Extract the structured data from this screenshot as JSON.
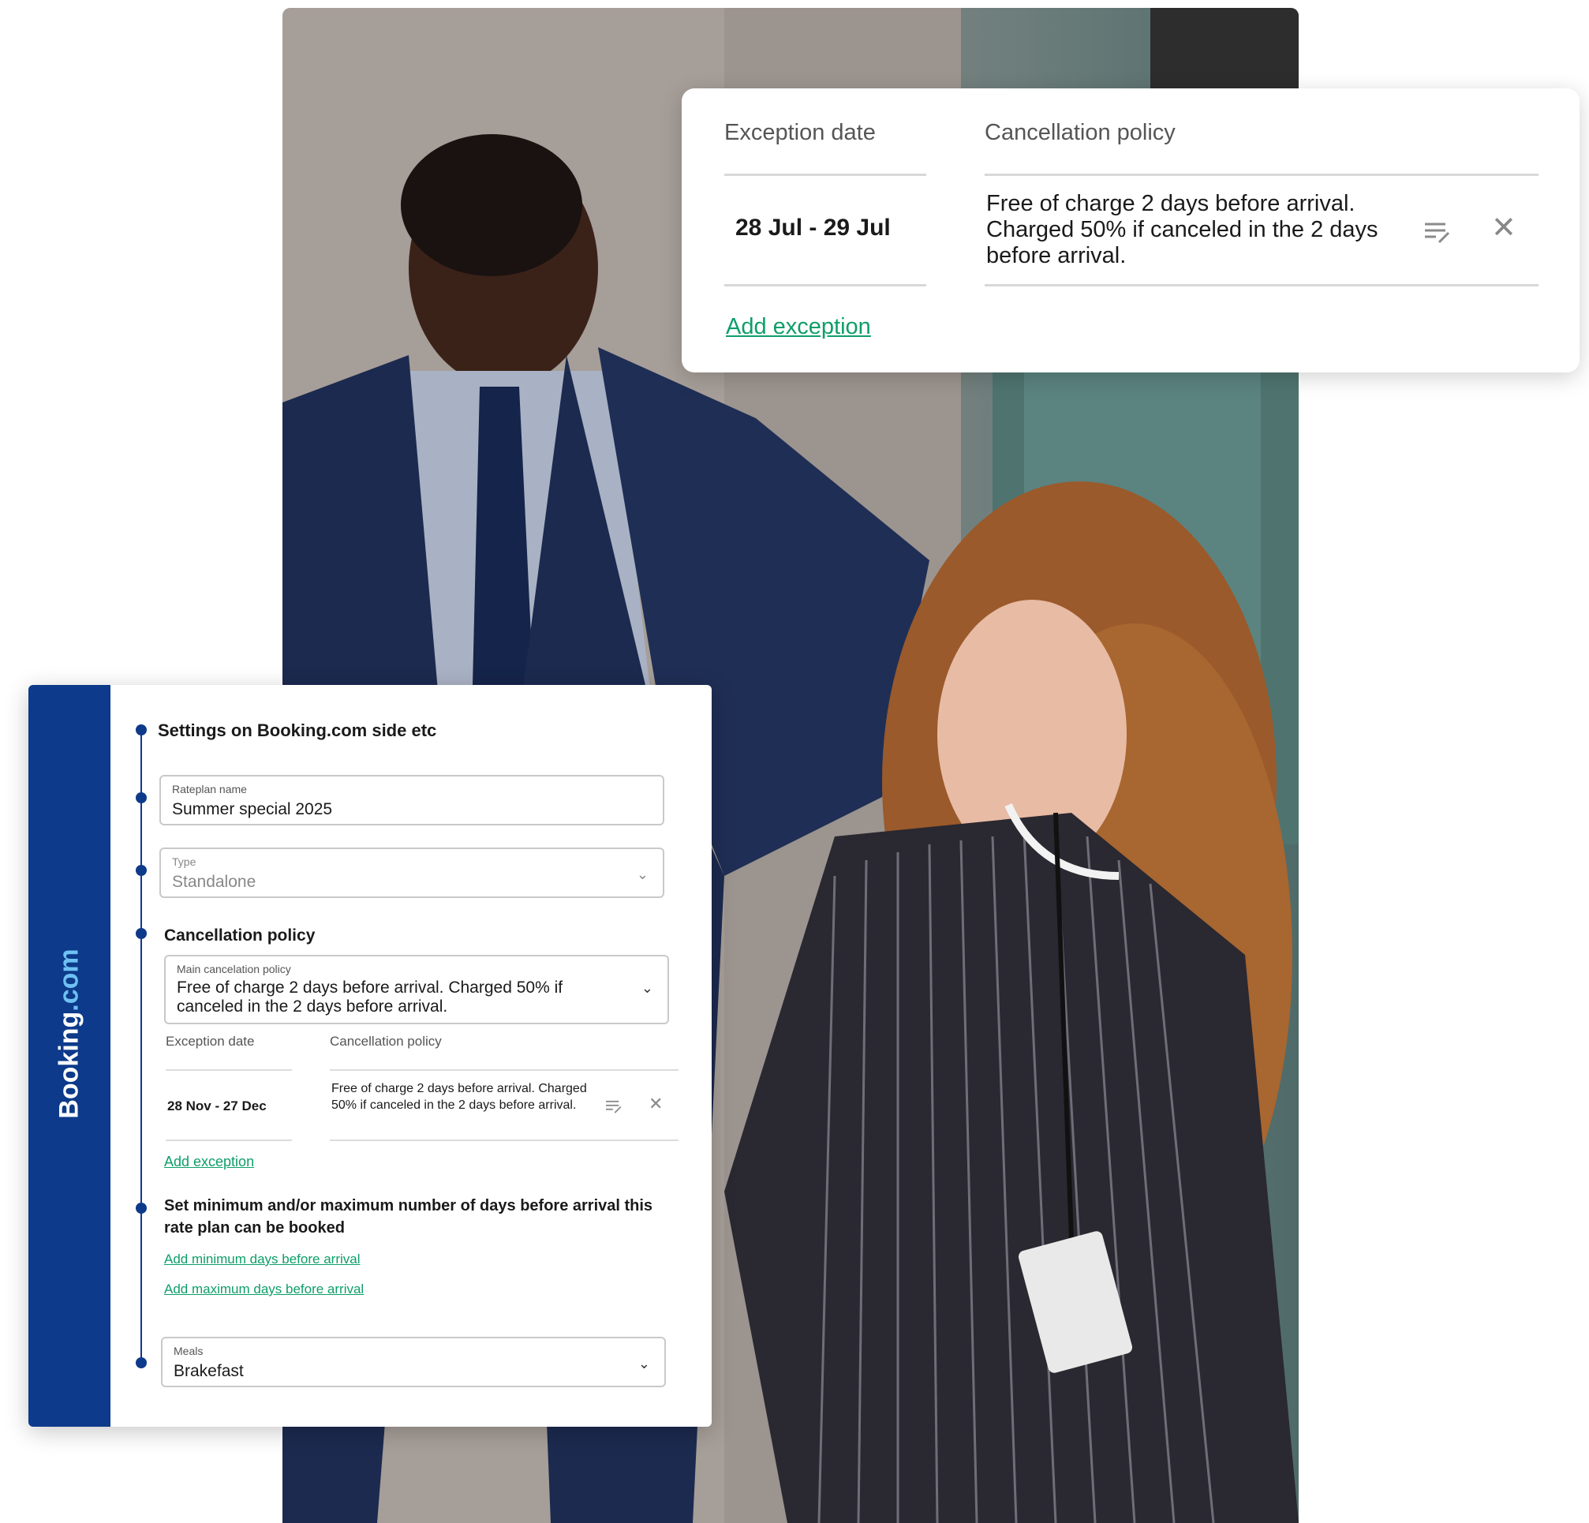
{
  "exception_card": {
    "header_date": "Exception date",
    "header_policy": "Cancellation policy",
    "row": {
      "date": "28 Jul  - 29 Jul",
      "policy": "Free of charge 2 days before arrival. Charged 50% if canceled in the 2 days before arrival."
    },
    "add_exception": "Add exception",
    "edit_icon": "edit-list-icon",
    "close_icon": "close-icon"
  },
  "settings": {
    "brand": {
      "name": "Booking",
      "tld": ".com"
    },
    "title": "Settings on Booking.com side etc",
    "rateplan": {
      "label": "Rateplan name",
      "value": "Summer special 2025"
    },
    "type": {
      "label": "Type",
      "value": "Standalone"
    },
    "cancellation_title": "Cancellation policy",
    "main_policy": {
      "label": "Main cancelation policy",
      "value": "Free of charge 2 days before arrival. Charged 50% if canceled in the 2 days before arrival."
    },
    "exceptions": {
      "header_date": "Exception date",
      "header_policy": "Cancellation policy",
      "row": {
        "date": "28 Nov  - 27 Dec",
        "policy": "Free of charge 2 days before arrival. Charged 50% if canceled in the 2 days before arrival."
      },
      "add_exception": "Add exception"
    },
    "min_max_title": "Set minimum and/or maximum number of days before arrival this rate plan can be booked",
    "add_min": "Add minimum days before arrival",
    "add_max": "Add maximum days before arrival",
    "meals": {
      "label": "Meals",
      "value": "Brakefast"
    },
    "colors": {
      "brand_blue": "#0d3a8a",
      "link_green": "#0e9e6a",
      "brand_dot": "#6ec1f3"
    }
  }
}
